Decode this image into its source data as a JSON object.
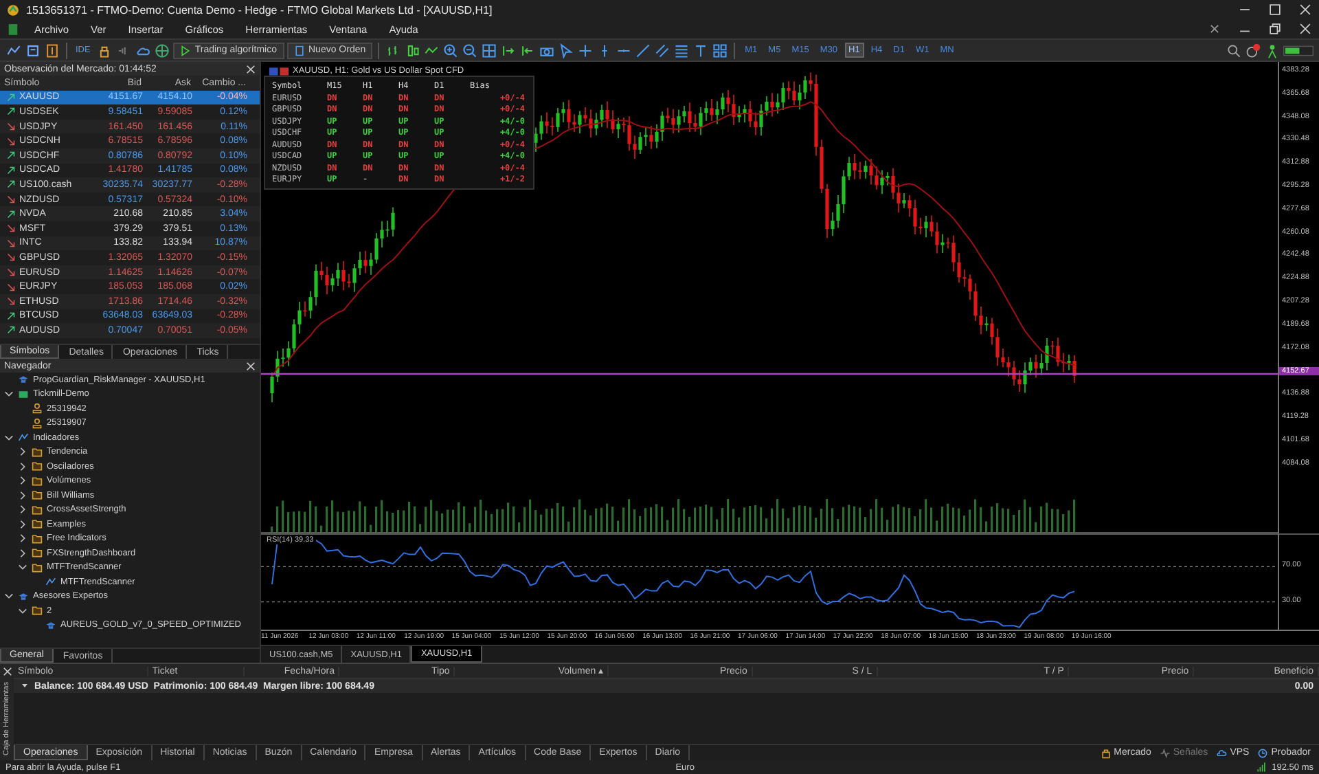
{
  "window": {
    "title": "1513651371 - FTMO-Demo: Cuenta Demo - Hedge - FTMO Global Markets Ltd - [XAUUSD,H1]"
  },
  "menu": [
    "Archivo",
    "Ver",
    "Insertar",
    "Gráficos",
    "Herramientas",
    "Ventana",
    "Ayuda"
  ],
  "toolbar": {
    "ide_label": "IDE",
    "algo_trading": "Trading algorítmico",
    "new_order": "Nuevo Orden",
    "timeframes": [
      {
        "label": "M1",
        "selected": false
      },
      {
        "label": "M5",
        "selected": false
      },
      {
        "label": "M15",
        "selected": false
      },
      {
        "label": "M30",
        "selected": false
      },
      {
        "label": "H1",
        "selected": true
      },
      {
        "label": "H4",
        "selected": false
      },
      {
        "label": "D1",
        "selected": false
      },
      {
        "label": "W1",
        "selected": false
      },
      {
        "label": "MN",
        "selected": false
      }
    ]
  },
  "market_watch": {
    "title": "Observación del Mercado: 01:44:52",
    "columns": [
      "Símbolo",
      "Bid",
      "Ask",
      "Cambio ..."
    ],
    "rows": [
      {
        "symbol": "XAUUSD",
        "rising": true,
        "bid": {
          "text": "4151.67",
          "color": "#8fc4ff"
        },
        "ask": {
          "text": "4154.10",
          "color": "#8fc4ff"
        },
        "change": {
          "text": "-0.04%",
          "color": "#ffb0b0"
        },
        "selected": true
      },
      {
        "symbol": "USDSEK",
        "rising": true,
        "bid": {
          "text": "9.58451",
          "color": "#4a9af0"
        },
        "ask": {
          "text": "9.59085",
          "color": "#e05555"
        },
        "change": {
          "text": "0.12%",
          "color": "#4a9af0"
        },
        "selected": false
      },
      {
        "symbol": "USDJPY",
        "rising": false,
        "bid": {
          "text": "161.450",
          "color": "#e05555"
        },
        "ask": {
          "text": "161.456",
          "color": "#e05555"
        },
        "change": {
          "text": "0.11%",
          "color": "#4a9af0"
        },
        "selected": false
      },
      {
        "symbol": "USDCNH",
        "rising": false,
        "bid": {
          "text": "6.78515",
          "color": "#e05555"
        },
        "ask": {
          "text": "6.78596",
          "color": "#e05555"
        },
        "change": {
          "text": "0.08%",
          "color": "#4a9af0"
        },
        "selected": false
      },
      {
        "symbol": "USDCHF",
        "rising": true,
        "bid": {
          "text": "0.80786",
          "color": "#4a9af0"
        },
        "ask": {
          "text": "0.80792",
          "color": "#e05555"
        },
        "change": {
          "text": "0.10%",
          "color": "#4a9af0"
        },
        "selected": false
      },
      {
        "symbol": "USDCAD",
        "rising": true,
        "bid": {
          "text": "1.41780",
          "color": "#e05555"
        },
        "ask": {
          "text": "1.41785",
          "color": "#4a9af0"
        },
        "change": {
          "text": "0.08%",
          "color": "#4a9af0"
        },
        "selected": false
      },
      {
        "symbol": "US100.cash",
        "rising": true,
        "bid": {
          "text": "30235.74",
          "color": "#4a9af0"
        },
        "ask": {
          "text": "30237.77",
          "color": "#4a9af0"
        },
        "change": {
          "text": "-0.28%",
          "color": "#e05555"
        },
        "selected": false
      },
      {
        "symbol": "NZDUSD",
        "rising": false,
        "bid": {
          "text": "0.57317",
          "color": "#4a9af0"
        },
        "ask": {
          "text": "0.57324",
          "color": "#e05555"
        },
        "change": {
          "text": "-0.10%",
          "color": "#e05555"
        },
        "selected": false
      },
      {
        "symbol": "NVDA",
        "rising": true,
        "bid": {
          "text": "210.68",
          "color": "#dcdcdc"
        },
        "ask": {
          "text": "210.85",
          "color": "#dcdcdc"
        },
        "change": {
          "text": "3.04%",
          "color": "#4a9af0"
        },
        "selected": false
      },
      {
        "symbol": "MSFT",
        "rising": false,
        "bid": {
          "text": "379.29",
          "color": "#dcdcdc"
        },
        "ask": {
          "text": "379.51",
          "color": "#dcdcdc"
        },
        "change": {
          "text": "0.13%",
          "color": "#4a9af0"
        },
        "selected": false
      },
      {
        "symbol": "INTC",
        "rising": false,
        "bid": {
          "text": "133.82",
          "color": "#dcdcdc"
        },
        "ask": {
          "text": "133.94",
          "color": "#dcdcdc"
        },
        "change": {
          "text": "10.87%",
          "color": "#4a9af0"
        },
        "selected": false
      },
      {
        "symbol": "GBPUSD",
        "rising": false,
        "bid": {
          "text": "1.32065",
          "color": "#e05555"
        },
        "ask": {
          "text": "1.32070",
          "color": "#e05555"
        },
        "change": {
          "text": "-0.15%",
          "color": "#e05555"
        },
        "selected": false
      },
      {
        "symbol": "EURUSD",
        "rising": false,
        "bid": {
          "text": "1.14625",
          "color": "#e05555"
        },
        "ask": {
          "text": "1.14626",
          "color": "#e05555"
        },
        "change": {
          "text": "-0.07%",
          "color": "#e05555"
        },
        "selected": false
      },
      {
        "symbol": "EURJPY",
        "rising": false,
        "bid": {
          "text": "185.053",
          "color": "#e05555"
        },
        "ask": {
          "text": "185.068",
          "color": "#e05555"
        },
        "change": {
          "text": "0.02%",
          "color": "#4a9af0"
        },
        "selected": false
      },
      {
        "symbol": "ETHUSD",
        "rising": false,
        "bid": {
          "text": "1713.86",
          "color": "#e05555"
        },
        "ask": {
          "text": "1714.46",
          "color": "#e05555"
        },
        "change": {
          "text": "-0.32%",
          "color": "#e05555"
        },
        "selected": false
      },
      {
        "symbol": "BTCUSD",
        "rising": true,
        "bid": {
          "text": "63648.03",
          "color": "#4a9af0"
        },
        "ask": {
          "text": "63649.03",
          "color": "#4a9af0"
        },
        "change": {
          "text": "-0.28%",
          "color": "#e05555"
        },
        "selected": false
      },
      {
        "symbol": "AUDUSD",
        "rising": true,
        "bid": {
          "text": "0.70047",
          "color": "#4a9af0"
        },
        "ask": {
          "text": "0.70051",
          "color": "#e05555"
        },
        "change": {
          "text": "-0.05%",
          "color": "#e05555"
        },
        "selected": false
      }
    ],
    "tabs": [
      {
        "label": "Símbolos",
        "selected": true
      },
      {
        "label": "Detalles",
        "selected": false
      },
      {
        "label": "Operaciones",
        "selected": false
      },
      {
        "label": "Ticks",
        "selected": false
      }
    ]
  },
  "navigator": {
    "title": "Navegador",
    "items": [
      {
        "label": "PropGuardian_RiskManager - XAUUSD,H1",
        "kind": "expert"
      },
      {
        "label": "Tickmill-Demo",
        "kind": "server",
        "expanded": true,
        "children": [
          {
            "label": "25319942",
            "kind": "account"
          },
          {
            "label": "25319907",
            "kind": "account"
          }
        ]
      },
      {
        "label": "Indicadores",
        "kind": "indicator",
        "expanded": true,
        "children": [
          {
            "label": "Tendencia",
            "kind": "folder",
            "expanded": false
          },
          {
            "label": "Osciladores",
            "kind": "folder",
            "expanded": false
          },
          {
            "label": "Volúmenes",
            "kind": "folder",
            "expanded": false
          },
          {
            "label": "Bill Williams",
            "kind": "folder",
            "expanded": false
          },
          {
            "label": "CrossAssetStrength",
            "kind": "folder",
            "expanded": false
          },
          {
            "label": "Examples",
            "kind": "folder",
            "expanded": false
          },
          {
            "label": "Free Indicators",
            "kind": "folder",
            "expanded": false
          },
          {
            "label": "FXStrengthDashboard",
            "kind": "folder",
            "expanded": false
          },
          {
            "label": "MTFTrendScanner",
            "kind": "folder",
            "expanded": true,
            "children": [
              {
                "label": "MTFTrendScanner",
                "kind": "indicator"
              }
            ]
          }
        ]
      },
      {
        "label": "Asesores Expertos",
        "kind": "expert",
        "expanded": true,
        "children": [
          {
            "label": "2",
            "kind": "folder",
            "expanded": true,
            "children": [
              {
                "label": "AUREUS_GOLD_v7_0_SPEED_OPTIMIZED",
                "kind": "expert"
              }
            ]
          }
        ]
      }
    ],
    "tabs": [
      {
        "label": "General",
        "selected": true
      },
      {
        "label": "Favoritos",
        "selected": false
      }
    ]
  },
  "chart": {
    "title": "XAUUSD, H1:  Gold vs US Dollar  Spot CFD",
    "current_price": "4152.67",
    "price_axis": [
      "4383.28",
      "4365.68",
      "4348.08",
      "4330.48",
      "4312.88",
      "4295.28",
      "4277.68",
      "4260.08",
      "4242.48",
      "4224.88",
      "4207.28",
      "4189.68",
      "4172.08",
      "4136.88",
      "4119.28",
      "4101.68",
      "4084.08"
    ],
    "rsi_label": "RSI(14) 39.33",
    "rsi_axis": [
      "70.00",
      "30.00"
    ],
    "time_axis": [
      "11 Jun 2026",
      "12 Jun 03:00",
      "12 Jun 11:00",
      "12 Jun 19:00",
      "15 Jun 04:00",
      "15 Jun 12:00",
      "15 Jun 20:00",
      "16 Jun 05:00",
      "16 Jun 13:00",
      "16 Jun 21:00",
      "17 Jun 06:00",
      "17 Jun 14:00",
      "17 Jun 22:00",
      "18 Jun 07:00",
      "18 Jun 15:00",
      "18 Jun 23:00",
      "19 Jun 08:00",
      "19 Jun 16:00"
    ],
    "scanner": {
      "columns": [
        "Symbol",
        "M15",
        "H1",
        "H4",
        "D1",
        "Bias"
      ],
      "rows": [
        [
          {
            "text": "EURUSD"
          },
          {
            "text": "DN",
            "color": "#e04040"
          },
          {
            "text": "DN",
            "color": "#e04040"
          },
          {
            "text": "DN",
            "color": "#e04040"
          },
          {
            "text": "DN",
            "color": "#e04040"
          },
          {
            "text": "+0/-4",
            "color": "#e04040"
          }
        ],
        [
          {
            "text": "GBPUSD"
          },
          {
            "text": "DN",
            "color": "#e04040"
          },
          {
            "text": "DN",
            "color": "#e04040"
          },
          {
            "text": "DN",
            "color": "#e04040"
          },
          {
            "text": "DN",
            "color": "#e04040"
          },
          {
            "text": "+0/-4",
            "color": "#e04040"
          }
        ],
        [
          {
            "text": "USDJPY"
          },
          {
            "text": "UP",
            "color": "#3fcf3f"
          },
          {
            "text": "UP",
            "color": "#3fcf3f"
          },
          {
            "text": "UP",
            "color": "#3fcf3f"
          },
          {
            "text": "UP",
            "color": "#3fcf3f"
          },
          {
            "text": "+4/-0",
            "color": "#3fcf3f"
          }
        ],
        [
          {
            "text": "USDCHF"
          },
          {
            "text": "UP",
            "color": "#3fcf3f"
          },
          {
            "text": "UP",
            "color": "#3fcf3f"
          },
          {
            "text": "UP",
            "color": "#3fcf3f"
          },
          {
            "text": "UP",
            "color": "#3fcf3f"
          },
          {
            "text": "+4/-0",
            "color": "#3fcf3f"
          }
        ],
        [
          {
            "text": "AUDUSD"
          },
          {
            "text": "DN",
            "color": "#e04040"
          },
          {
            "text": "DN",
            "color": "#e04040"
          },
          {
            "text": "DN",
            "color": "#e04040"
          },
          {
            "text": "DN",
            "color": "#e04040"
          },
          {
            "text": "+0/-4",
            "color": "#e04040"
          }
        ],
        [
          {
            "text": "USDCAD"
          },
          {
            "text": "UP",
            "color": "#3fcf3f"
          },
          {
            "text": "UP",
            "color": "#3fcf3f"
          },
          {
            "text": "UP",
            "color": "#3fcf3f"
          },
          {
            "text": "UP",
            "color": "#3fcf3f"
          },
          {
            "text": "+4/-0",
            "color": "#3fcf3f"
          }
        ],
        [
          {
            "text": "NZDUSD"
          },
          {
            "text": "DN",
            "color": "#e04040"
          },
          {
            "text": "DN",
            "color": "#e04040"
          },
          {
            "text": "DN",
            "color": "#e04040"
          },
          {
            "text": "DN",
            "color": "#e04040"
          },
          {
            "text": "+0/-4",
            "color": "#e04040"
          }
        ],
        [
          {
            "text": "EURJPY"
          },
          {
            "text": "UP",
            "color": "#3fcf3f"
          },
          {
            "text": "-",
            "color": "#888888"
          },
          {
            "text": "DN",
            "color": "#e04040"
          },
          {
            "text": "DN",
            "color": "#e04040"
          },
          {
            "text": "+1/-2",
            "color": "#e04040"
          }
        ]
      ]
    },
    "tabs": [
      {
        "label": "US100.cash,M5",
        "selected": false
      },
      {
        "label": "XAUUSD,H1",
        "selected": false
      },
      {
        "label": "XAUUSD,H1",
        "selected": true
      }
    ]
  },
  "toolbox": {
    "side_label": "Caja de Herramientas",
    "columns": [
      "Símbolo",
      "Ticket",
      "Fecha/Hora",
      "Tipo",
      "Volumen ▴",
      "Precio",
      "S / L",
      "T / P",
      "Precio",
      "Beneficio"
    ],
    "balance": "Balance: 100 684.49 USD  Patrimonio: 100 684.49  Margen libre: 100 684.49",
    "profit": "0.00",
    "tabs": [
      {
        "label": "Operaciones",
        "selected": true
      },
      {
        "label": "Exposición",
        "selected": false
      },
      {
        "label": "Historial",
        "selected": false
      },
      {
        "label": "Noticias",
        "selected": false
      },
      {
        "label": "Buzón",
        "selected": false
      },
      {
        "label": "Calendario",
        "selected": false
      },
      {
        "label": "Empresa",
        "selected": false
      },
      {
        "label": "Alertas",
        "selected": false
      },
      {
        "label": "Artículos",
        "selected": false
      },
      {
        "label": "Code Base",
        "selected": false
      },
      {
        "label": "Expertos",
        "selected": false
      },
      {
        "label": "Diario",
        "selected": false
      }
    ],
    "services": [
      "Mercado",
      "Señales",
      "VPS",
      "Probador"
    ]
  },
  "status_bar": {
    "help": "Para abrir la Ayuda, pulse F1",
    "profile": "Euro",
    "ping": "192.50 ms"
  }
}
